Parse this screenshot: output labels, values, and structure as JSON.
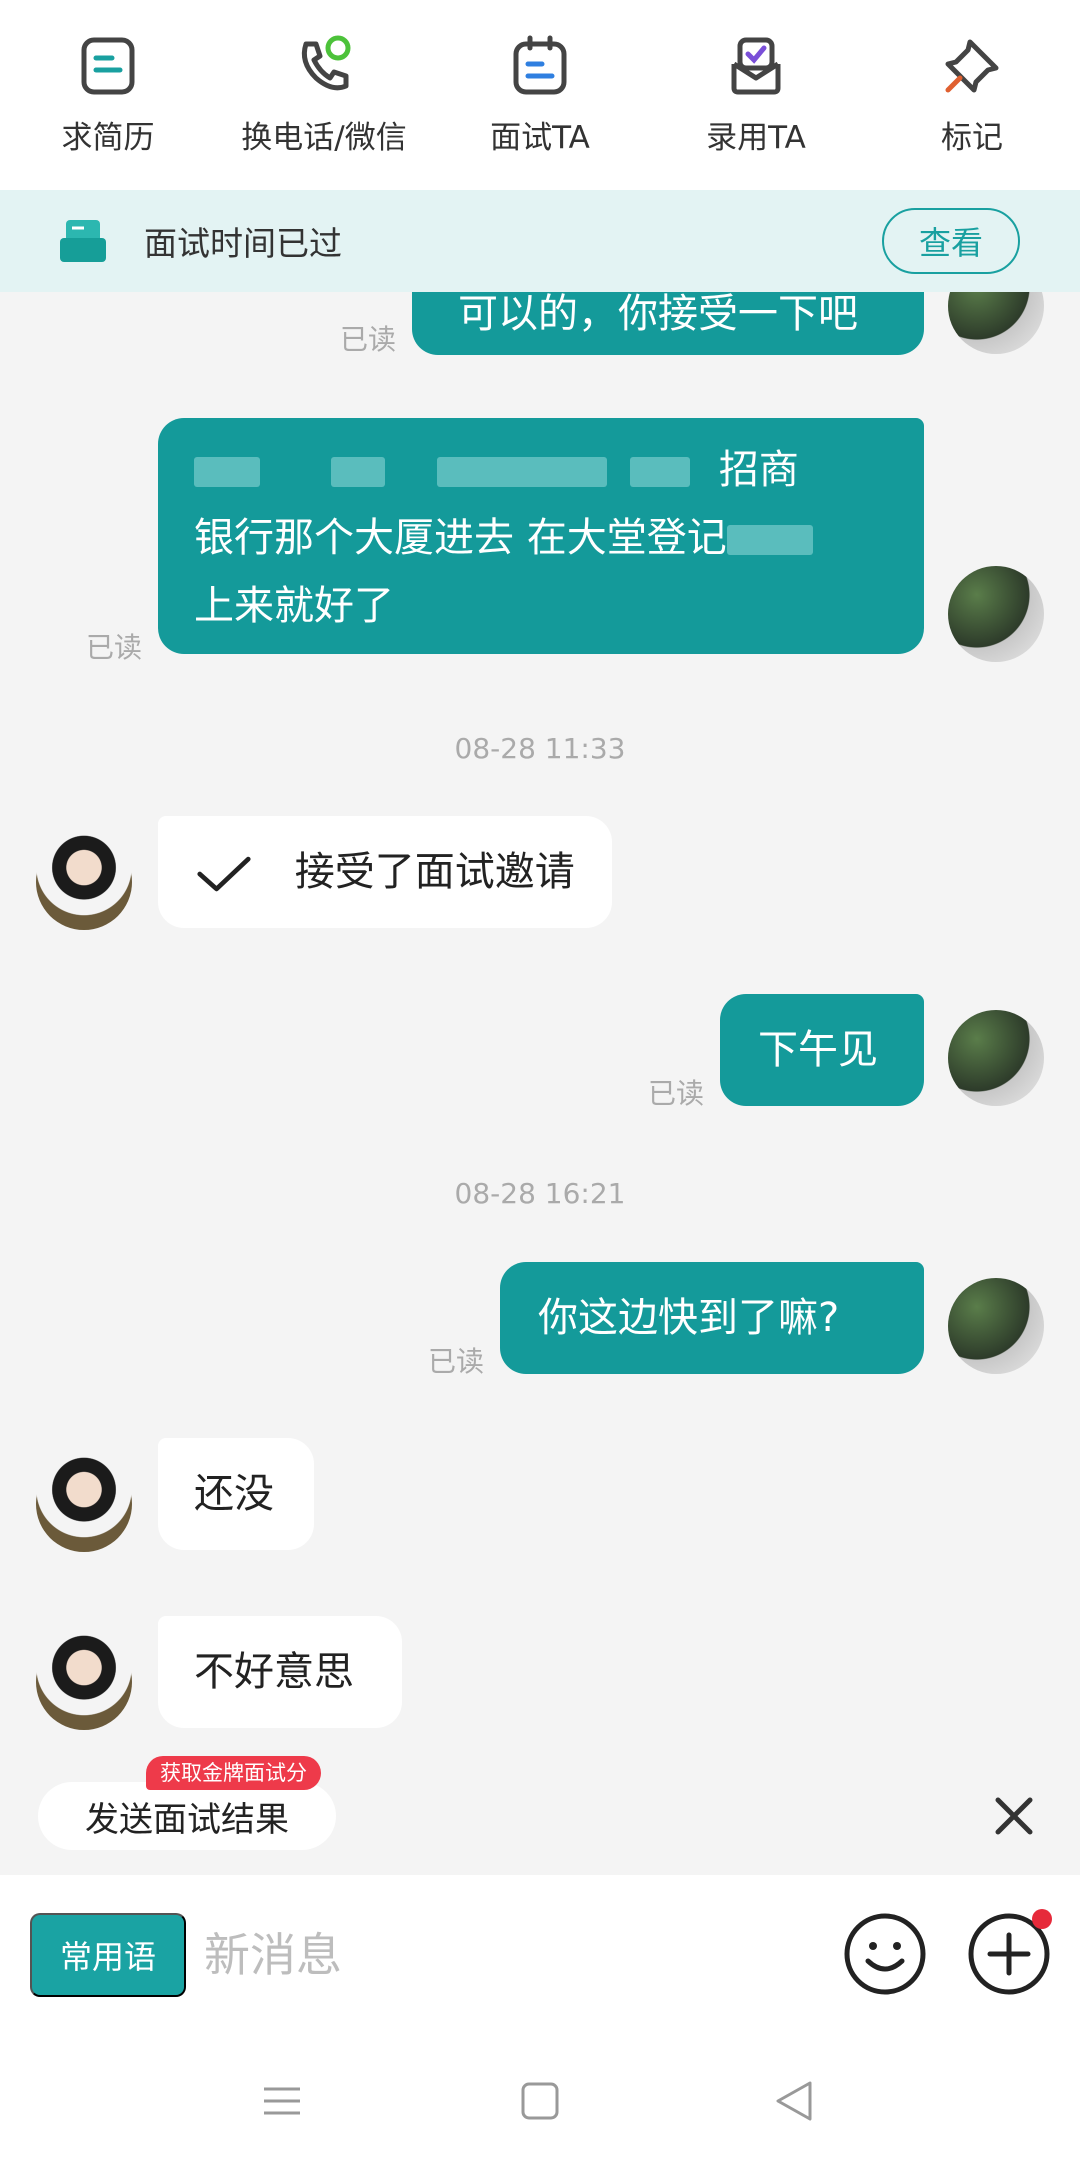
{
  "top_actions": [
    {
      "label": "求简历",
      "icon": "resume-icon"
    },
    {
      "label": "换电话/微信",
      "icon": "phone-wechat-icon"
    },
    {
      "label": "面试TA",
      "icon": "interview-calendar-icon"
    },
    {
      "label": "录用TA",
      "icon": "hire-icon"
    },
    {
      "label": "标记",
      "icon": "pin-icon"
    }
  ],
  "banner": {
    "text": "面试时间已过",
    "button": "查看",
    "icon": "interview-card-icon"
  },
  "chat": {
    "read_label": "已读",
    "messages": {
      "m1": "可以的，你接受一下吧",
      "m2_line1_tail": "招商",
      "m2_line2": "银行那个大厦进去   在大堂登记",
      "m2_line3": "上来就好了",
      "time1": "08-28 11:33",
      "m3": "接受了面试邀请",
      "m4": "下午见",
      "time2": "08-28 16:21",
      "m5": "你这边快到了嘛?",
      "m6": "还没",
      "m7": "不好意思"
    }
  },
  "send_result": {
    "label": "发送面试结果",
    "badge": "获取金牌面试分"
  },
  "input": {
    "phrase_button": "常用语",
    "placeholder": "新消息"
  },
  "colors": {
    "accent": "#149a9a",
    "banner_bg": "#e3f3f3",
    "badge": "#ee3a4a"
  }
}
